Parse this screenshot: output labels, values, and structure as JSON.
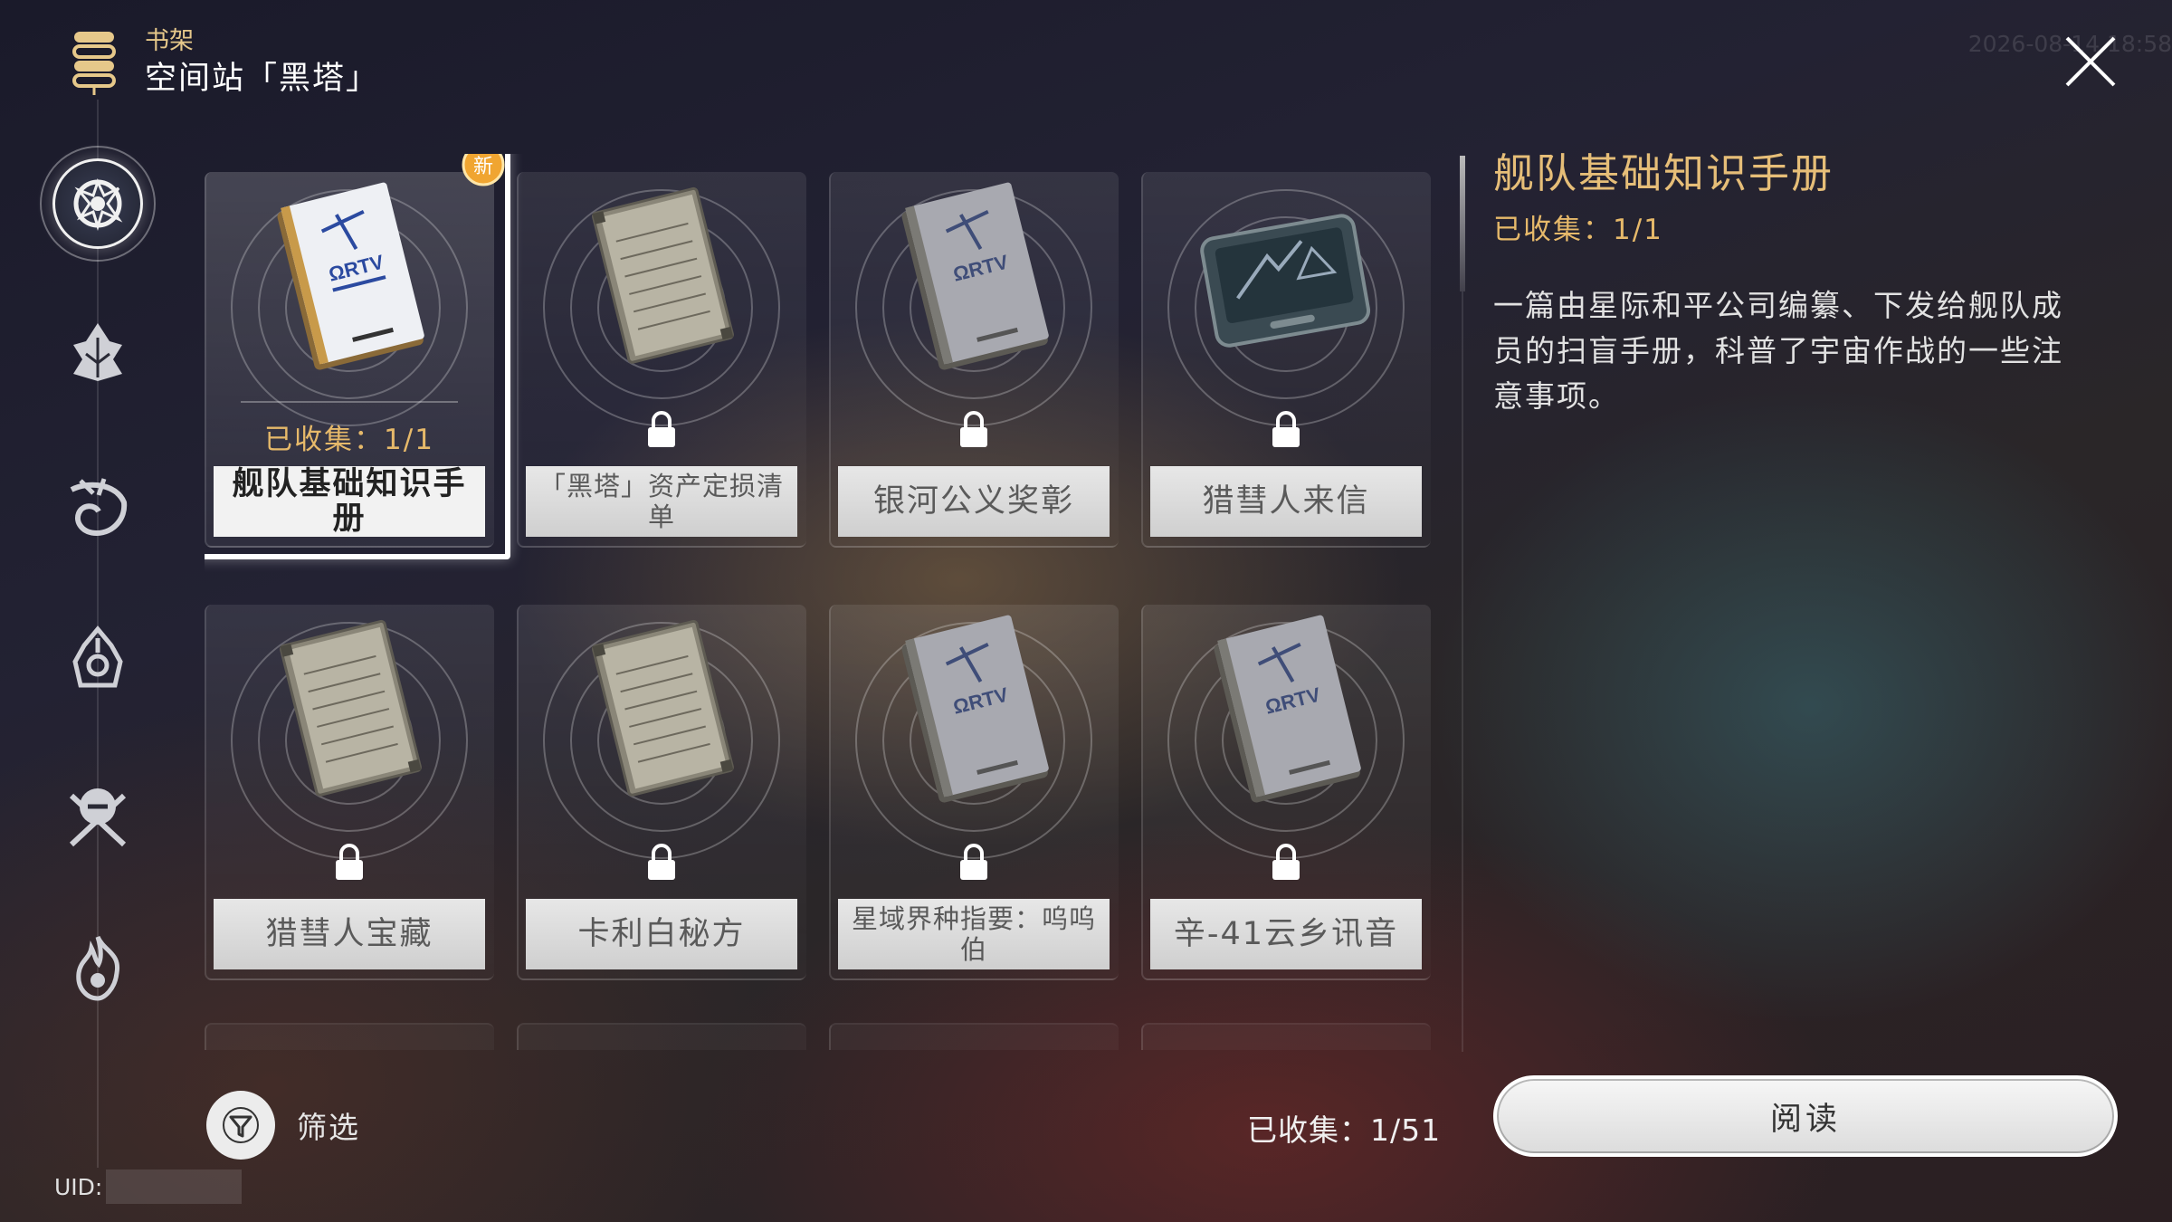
{
  "header": {
    "crumb": "书架",
    "place": "空间站「黑塔」",
    "timestamp": "2026-08-14 18:58"
  },
  "nav": {
    "items": [
      {
        "name": "nav-item-1",
        "icon": "space-station-emblem-icon",
        "active": true
      },
      {
        "name": "nav-item-2",
        "icon": "tree-emblem-icon",
        "active": false
      },
      {
        "name": "nav-item-3",
        "icon": "dragon-emblem-icon",
        "active": false
      },
      {
        "name": "nav-item-4",
        "icon": "spire-emblem-icon",
        "active": false
      },
      {
        "name": "nav-item-5",
        "icon": "crossed-emblem-icon",
        "active": false
      },
      {
        "name": "nav-item-6",
        "icon": "flame-emblem-icon",
        "active": false
      }
    ]
  },
  "uid": {
    "label": "UID:"
  },
  "books": [
    {
      "title": "舰队基础知识手册",
      "locked": false,
      "selected": true,
      "is_new": true,
      "new_label": "新",
      "collected": "已收集：1/1",
      "art": "manual"
    },
    {
      "title": "「黑塔」资产定损清单",
      "locked": true,
      "art": "notes"
    },
    {
      "title": "银河公义奖彰",
      "locked": true,
      "art": "manual"
    },
    {
      "title": "猎彗人来信",
      "locked": true,
      "art": "tablet"
    },
    {
      "title": "猎彗人宝藏",
      "locked": true,
      "art": "notes"
    },
    {
      "title": "卡利白秘方",
      "locked": true,
      "art": "notes"
    },
    {
      "title": "星域界种指要：呜呜伯",
      "locked": true,
      "art": "manual"
    },
    {
      "title": "辛-41云乡讯音",
      "locked": true,
      "art": "manual"
    }
  ],
  "filter": {
    "label": "筛选"
  },
  "collected_total": "已收集：1/51",
  "detail": {
    "title": "舰队基础知识手册",
    "status": "已收集：1/1",
    "description": "一篇由星际和平公司编纂、下发给舰队成员的扫盲手册，科普了宇宙作战的一些注意事项。"
  },
  "read_button": {
    "label": "阅读"
  },
  "colors": {
    "accent_gold": "#e6b96a",
    "selected_frame": "#ffffff",
    "label_bg": "#d9d9d9"
  }
}
